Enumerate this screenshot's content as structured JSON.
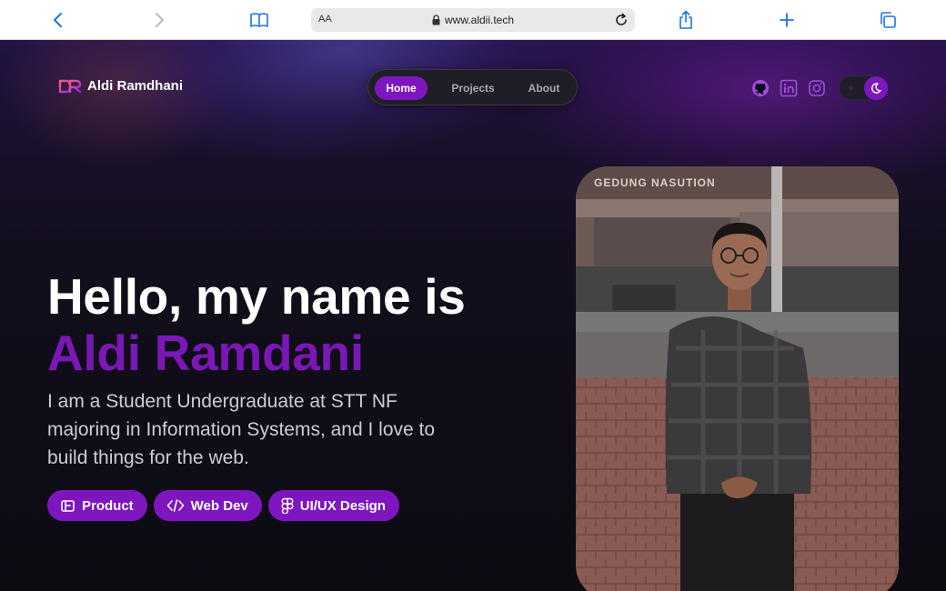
{
  "browser": {
    "text_size_label": "AA",
    "url": "www.aldii.tech",
    "icons": [
      "back-icon",
      "forward-icon",
      "bookmarks-icon",
      "lock-icon",
      "reload-icon",
      "share-icon",
      "new-tab-icon",
      "tabs-icon"
    ]
  },
  "header": {
    "brand_name": "Aldi Ramdhani",
    "nav": [
      {
        "label": "Home",
        "active": true
      },
      {
        "label": "Projects",
        "active": false
      },
      {
        "label": "About",
        "active": false
      }
    ],
    "social_icons": [
      "github-icon",
      "linkedin-icon",
      "instagram-icon"
    ],
    "theme_toggle": {
      "mode": "dark"
    }
  },
  "hero": {
    "greeting": "Hello, my name is",
    "name": "Aldi Ramdani",
    "description": "I am a Student Undergraduate at STT NF majoring in Information Systems, and I love to build things for the web.",
    "tags": [
      {
        "label": "Product",
        "icon": "wallet-icon"
      },
      {
        "label": "Web Dev",
        "icon": "code-icon"
      },
      {
        "label": "UI/UX Design",
        "icon": "figma-icon"
      }
    ],
    "photo_sign": "GEDUNG NASUTION"
  },
  "colors": {
    "accent": "#7e16c0",
    "name_color": "#7a17b6",
    "browser_icon": "#1a73e8",
    "background": "#0d0b12"
  }
}
